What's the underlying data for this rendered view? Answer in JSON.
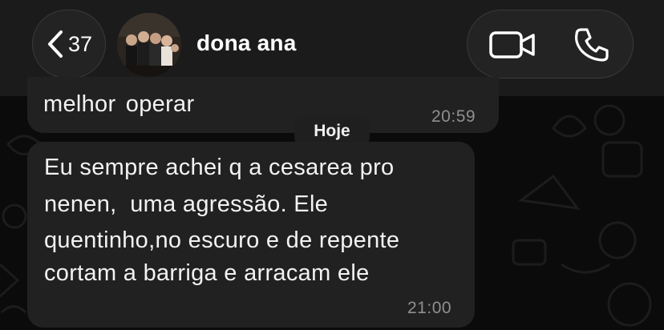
{
  "header": {
    "back_count": "37",
    "contact_name": "dona ana"
  },
  "messages": [
    {
      "text": "melhor  operar",
      "time": "20:59"
    },
    {
      "lines": [
        "Eu sempre achei q a cesarea pro",
        "nenen,  uma agressão. Ele",
        "quentinho,no escuro e de repente",
        "cortam a barriga e arracam ele"
      ],
      "time": "21:00"
    }
  ],
  "date_separator": "Hoje",
  "icons": [
    "back-chevron-icon",
    "video-call-icon",
    "phone-call-icon"
  ],
  "colors": {
    "background": "#0b0b0b",
    "bubble": "#212121",
    "header": "#1b1b1b"
  }
}
